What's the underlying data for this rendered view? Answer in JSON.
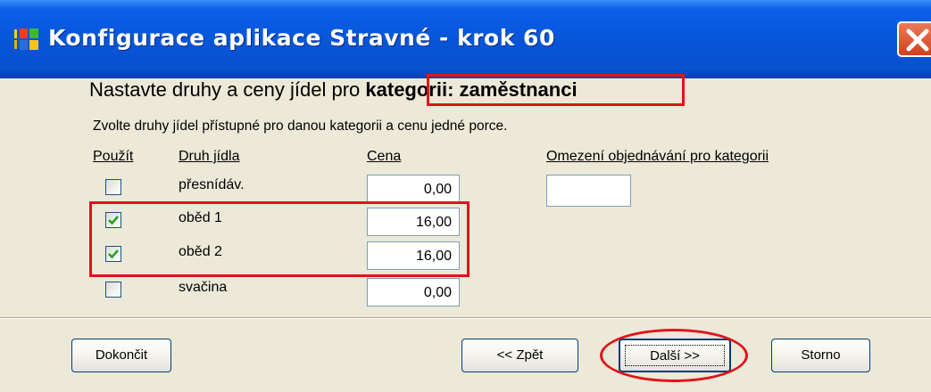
{
  "window": {
    "title": "Konfigurace aplikace Stravné - krok 60"
  },
  "heading": {
    "prefix": "Nastavte druhy a ceny jídel pro ",
    "highlight": "kategorii: zaměstnanci"
  },
  "subtitle": "Zvolte druhy jídel přístupné pro danou kategorii a cenu jedné porce.",
  "columns": {
    "use": "Použít",
    "meal_type": "Druh jídla",
    "price": "Cena",
    "order_limit": "Omezení objednávání pro kategorii"
  },
  "meals": [
    {
      "label": "přesnídáv.",
      "checked": false,
      "price": "0,00"
    },
    {
      "label": "oběd 1",
      "checked": true,
      "price": "16,00"
    },
    {
      "label": "oběd 2",
      "checked": true,
      "price": "16,00"
    },
    {
      "label": "svačina",
      "checked": false,
      "price": "0,00"
    }
  ],
  "order_limit_value": "",
  "buttons": {
    "finish": "Dokončit",
    "back": "<< Zpět",
    "next": "Další >>",
    "cancel": "Storno"
  },
  "colors": {
    "titlebar": "#0856d9",
    "highlight_red": "#e0141b",
    "dialog_bg": "#ece9d8"
  }
}
